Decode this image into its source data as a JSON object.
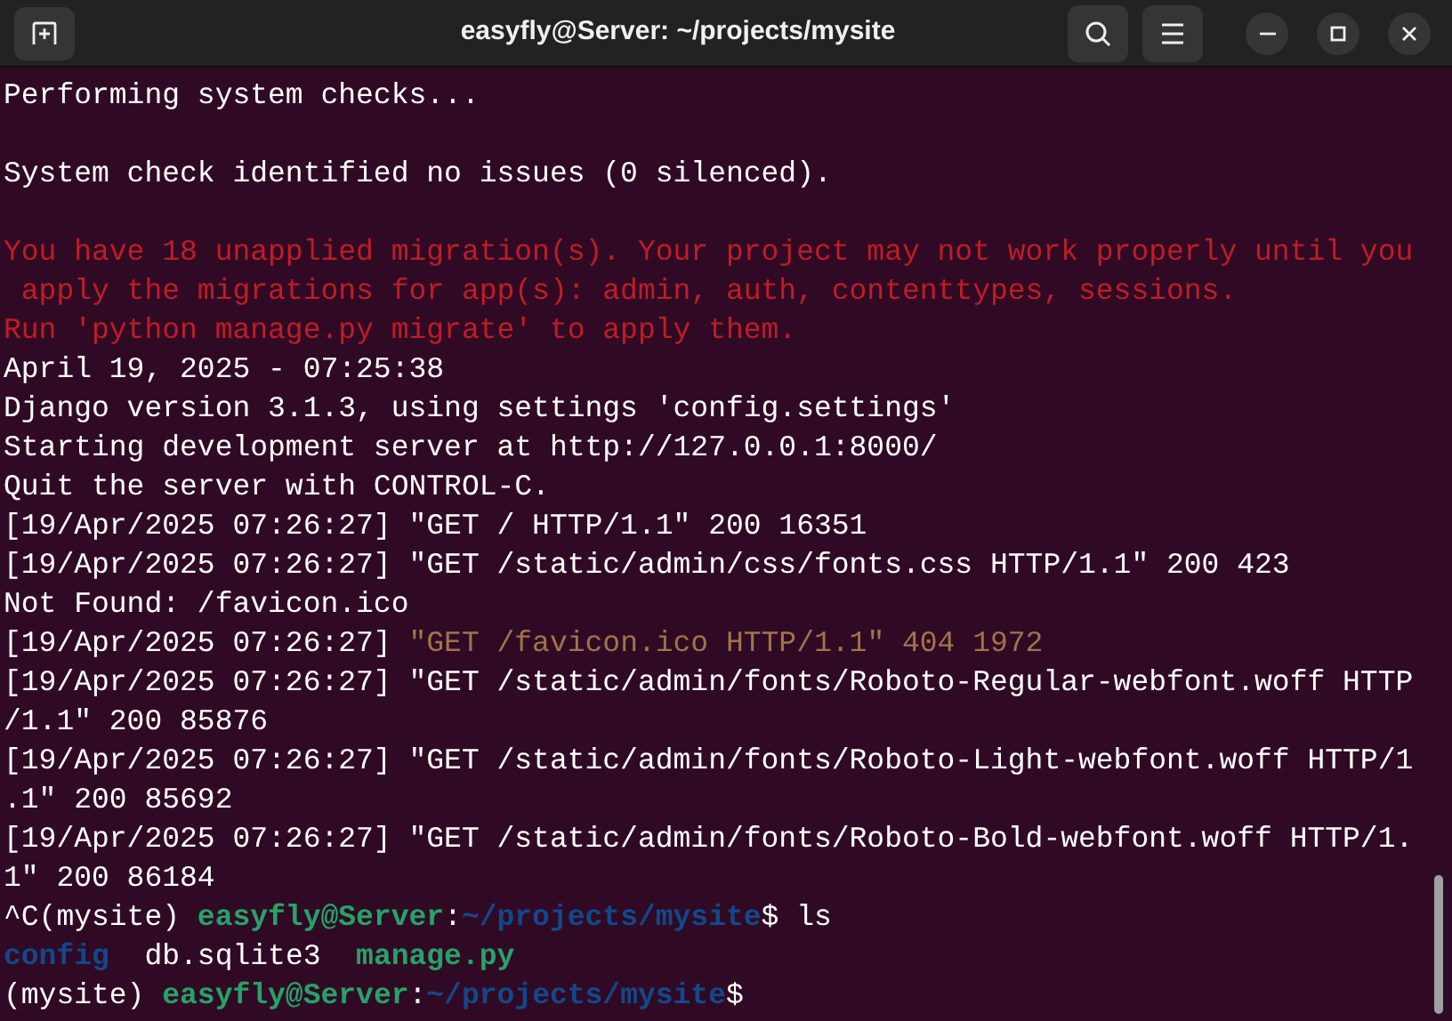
{
  "window": {
    "title": "easyfly@Server: ~/projects/mysite"
  },
  "terminal": {
    "lines": [
      {
        "kind": "text",
        "segments": [
          {
            "text": "Performing system checks...",
            "color": "#ffffff"
          }
        ]
      },
      {
        "kind": "blank"
      },
      {
        "kind": "text",
        "segments": [
          {
            "text": "System check identified no issues (0 silenced).",
            "color": "#ffffff"
          }
        ]
      },
      {
        "kind": "blank"
      },
      {
        "kind": "text",
        "segments": [
          {
            "text": "You have 18 unapplied migration(s). Your project may not work properly until you",
            "color": "#c01c28"
          }
        ]
      },
      {
        "kind": "text",
        "segments": [
          {
            "text": " apply the migrations for app(s): admin, auth, contenttypes, sessions.",
            "color": "#c01c28"
          }
        ]
      },
      {
        "kind": "text",
        "segments": [
          {
            "text": "Run 'python manage.py migrate' to apply them.",
            "color": "#c01c28"
          }
        ]
      },
      {
        "kind": "text",
        "segments": [
          {
            "text": "April 19, 2025 - 07:25:38",
            "color": "#ffffff"
          }
        ]
      },
      {
        "kind": "text",
        "segments": [
          {
            "text": "Django version 3.1.3, using settings 'config.settings'",
            "color": "#ffffff"
          }
        ]
      },
      {
        "kind": "text",
        "segments": [
          {
            "text": "Starting development server at http://127.0.0.1:8000/",
            "color": "#ffffff"
          }
        ]
      },
      {
        "kind": "text",
        "segments": [
          {
            "text": "Quit the server with CONTROL-C.",
            "color": "#ffffff"
          }
        ]
      },
      {
        "kind": "text",
        "segments": [
          {
            "text": "[19/Apr/2025 07:26:27] \"GET / HTTP/1.1\" 200 16351",
            "color": "#ffffff"
          }
        ]
      },
      {
        "kind": "text",
        "segments": [
          {
            "text": "[19/Apr/2025 07:26:27] \"GET /static/admin/css/fonts.css HTTP/1.1\" 200 423",
            "color": "#ffffff"
          }
        ]
      },
      {
        "kind": "text",
        "segments": [
          {
            "text": "Not Found: /favicon.ico",
            "color": "#ffffff"
          }
        ]
      },
      {
        "kind": "text",
        "segments": [
          {
            "text": "[19/Apr/2025 07:26:27] ",
            "color": "#ffffff"
          },
          {
            "text": "\"GET /favicon.ico HTTP/1.1\" 404 1972",
            "color": "#a2734c"
          }
        ]
      },
      {
        "kind": "text",
        "segments": [
          {
            "text": "[19/Apr/2025 07:26:27] \"GET /static/admin/fonts/Roboto-Regular-webfont.woff HTTP",
            "color": "#ffffff"
          }
        ]
      },
      {
        "kind": "text",
        "segments": [
          {
            "text": "/1.1\" 200 85876",
            "color": "#ffffff"
          }
        ]
      },
      {
        "kind": "text",
        "segments": [
          {
            "text": "[19/Apr/2025 07:26:27] \"GET /static/admin/fonts/Roboto-Light-webfont.woff HTTP/1",
            "color": "#ffffff"
          }
        ]
      },
      {
        "kind": "text",
        "segments": [
          {
            "text": ".1\" 200 85692",
            "color": "#ffffff"
          }
        ]
      },
      {
        "kind": "text",
        "segments": [
          {
            "text": "[19/Apr/2025 07:26:27] \"GET /static/admin/fonts/Roboto-Bold-webfont.woff HTTP/1.",
            "color": "#ffffff"
          }
        ]
      },
      {
        "kind": "text",
        "segments": [
          {
            "text": "1\" 200 86184",
            "color": "#ffffff"
          }
        ]
      },
      {
        "kind": "text",
        "segments": [
          {
            "text": "^C(mysite) ",
            "color": "#ffffff"
          },
          {
            "text": "easyfly@Server",
            "color": "#26a269",
            "bold": true
          },
          {
            "text": ":",
            "color": "#ffffff"
          },
          {
            "text": "~/projects/mysite",
            "color": "#12488b",
            "bold": true
          },
          {
            "text": "$ ls",
            "color": "#ffffff"
          }
        ]
      },
      {
        "kind": "text",
        "segments": [
          {
            "text": "config",
            "color": "#12488b",
            "bold": true
          },
          {
            "text": "  db.sqlite3  ",
            "color": "#ffffff"
          },
          {
            "text": "manage.py",
            "color": "#26a269",
            "bold": true
          }
        ]
      },
      {
        "kind": "text",
        "segments": [
          {
            "text": "(mysite) ",
            "color": "#ffffff"
          },
          {
            "text": "easyfly@Server",
            "color": "#26a269",
            "bold": true
          },
          {
            "text": ":",
            "color": "#ffffff"
          },
          {
            "text": "~/projects/mysite",
            "color": "#12488b",
            "bold": true
          },
          {
            "text": "$",
            "color": "#ffffff"
          }
        ]
      }
    ]
  }
}
